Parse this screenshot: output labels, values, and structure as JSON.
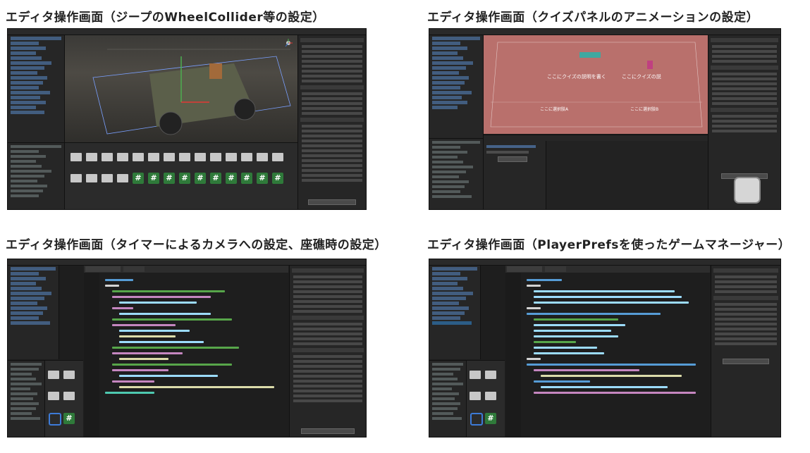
{
  "panels": [
    {
      "title": "エディタ操作画面（ジープのWheelCollider等の設定）"
    },
    {
      "title": "エディタ操作画面（クイズパネルのアニメーションの設定）"
    },
    {
      "title": "エディタ操作画面（タイマーによるカメラへの設定、座礁時の設定）"
    },
    {
      "title": "エディタ操作画面（PlayerPrefsを使ったゲームマネージャー）"
    }
  ],
  "quiz_texts": {
    "question_left": "ここにクイズの説明を書く",
    "question_right": "ここにクイズの説",
    "option_left": "ここに選択肢A",
    "option_right": "ここに選択肢B"
  },
  "icons": {
    "script_glyph": "#"
  },
  "colors": {
    "editor_bg": "#1e1e1e",
    "panel_bg": "#262626",
    "selection": "#2c5d87",
    "script_icon": "#2f7a3a",
    "quiz_scene": "#b9706c"
  }
}
